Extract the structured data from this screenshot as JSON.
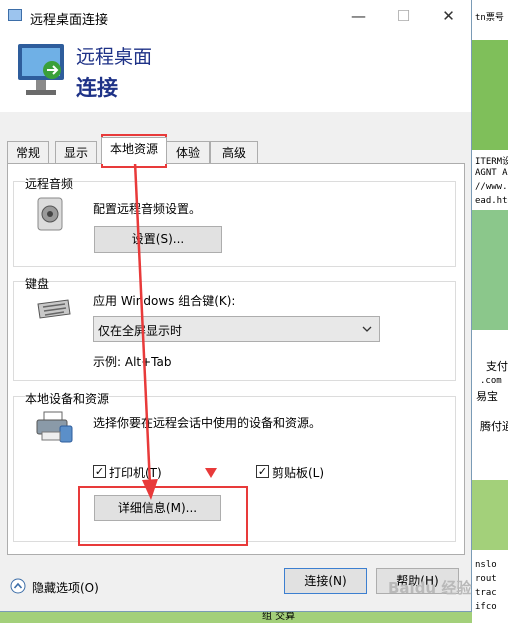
{
  "background": {
    "lines_top": [
      "tn票号"
    ],
    "lines_mid": [
      "ITERM设",
      "AGNT A",
      "//www.",
      "ead.htm"
    ],
    "lines_support": [
      "支付",
      ".com",
      "易宝",
      "腾付通"
    ],
    "lines_bottom": [
      "nslo",
      "rout",
      "trac",
      "ifco"
    ],
    "bottom_text": "组 交算"
  },
  "window": {
    "title": "远程桌面连接",
    "minimize": "—",
    "maximize": "☐",
    "close": "✕",
    "header_line1": "远程桌面",
    "header_line2": "连接"
  },
  "tabs": [
    {
      "label": "常规"
    },
    {
      "label": "显示"
    },
    {
      "label": "本地资源"
    },
    {
      "label": "体验"
    },
    {
      "label": "高级"
    }
  ],
  "audio": {
    "group_label": "远程音频",
    "description": "配置远程音频设置。",
    "settings_button": "设置(S)..."
  },
  "keyboard": {
    "group_label": "键盘",
    "prompt": "应用 Windows 组合键(K):",
    "selected_option": "仅在全屏显示时",
    "example": "示例: Alt+Tab"
  },
  "devices": {
    "group_label": "本地设备和资源",
    "description": "选择你要在远程会话中使用的设备和资源。",
    "printer_label": "打印机(T)",
    "printer_checked": true,
    "clipboard_label": "剪贴板(L)",
    "clipboard_checked": true,
    "details_button": "详细信息(M)..."
  },
  "footer": {
    "hide_options": "隐藏选项(O)",
    "connect_button": "连接(N)",
    "help_button": "帮助(H)"
  },
  "watermark": "Baidu 经验",
  "colors": {
    "annotation_red": "#e83a3a",
    "title_blue": "#1e3287"
  }
}
